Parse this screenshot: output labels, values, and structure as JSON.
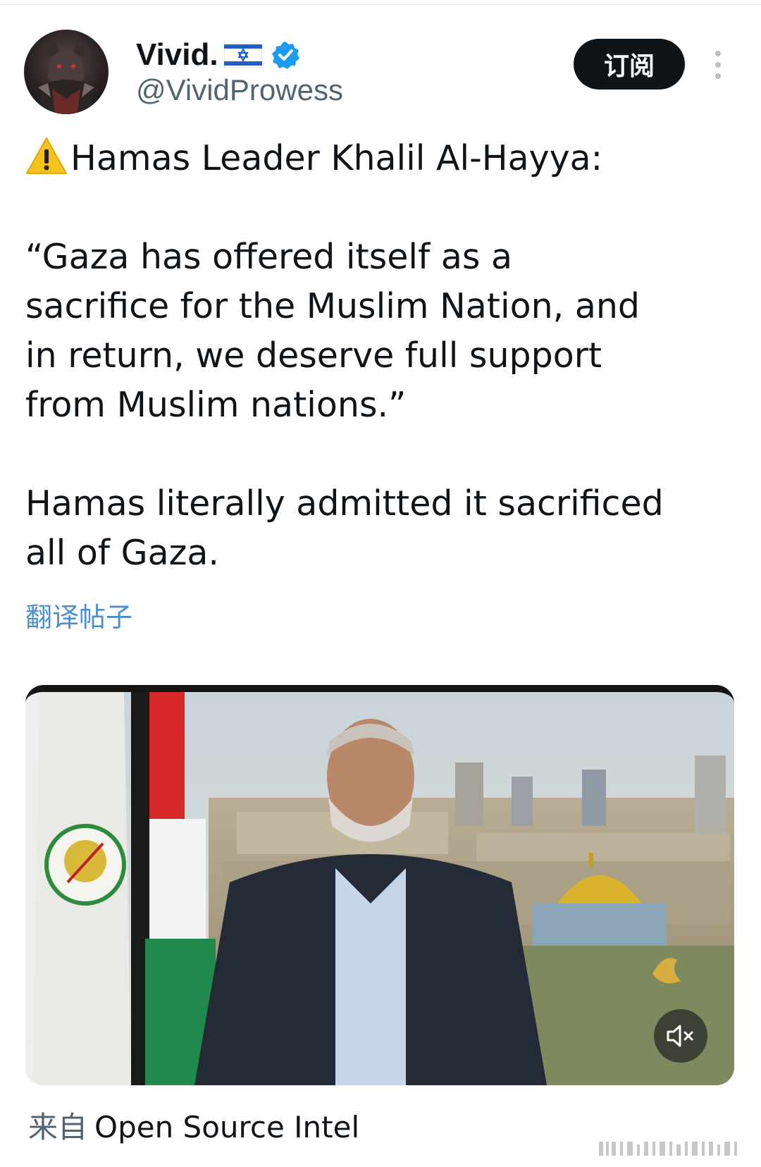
{
  "author": {
    "display_name": "Vivid.",
    "handle": "@VividProwess",
    "flag_icon": "israel-flag-icon",
    "verified_color": "#1d9bf0"
  },
  "actions": {
    "subscribe_label": "订阅"
  },
  "tweet": {
    "lines": [
      "Hamas Leader Khalil Al-Hayya:",
      "“Gaza has offered itself as a sacrifice for the Muslim Nation, and in return, we deserve full support from Muslim nations.”",
      "Hamas literally admitted it sacrificed all of Gaza."
    ],
    "translate_label": "翻译帖子"
  },
  "media": {
    "type": "video",
    "muted": true
  },
  "source": {
    "prefix": "来自",
    "name": "Open Source Intel"
  },
  "colors": {
    "text": "#0f1419",
    "secondary": "#536471",
    "link": "#4a8fd0",
    "button_bg": "#0f1419"
  }
}
